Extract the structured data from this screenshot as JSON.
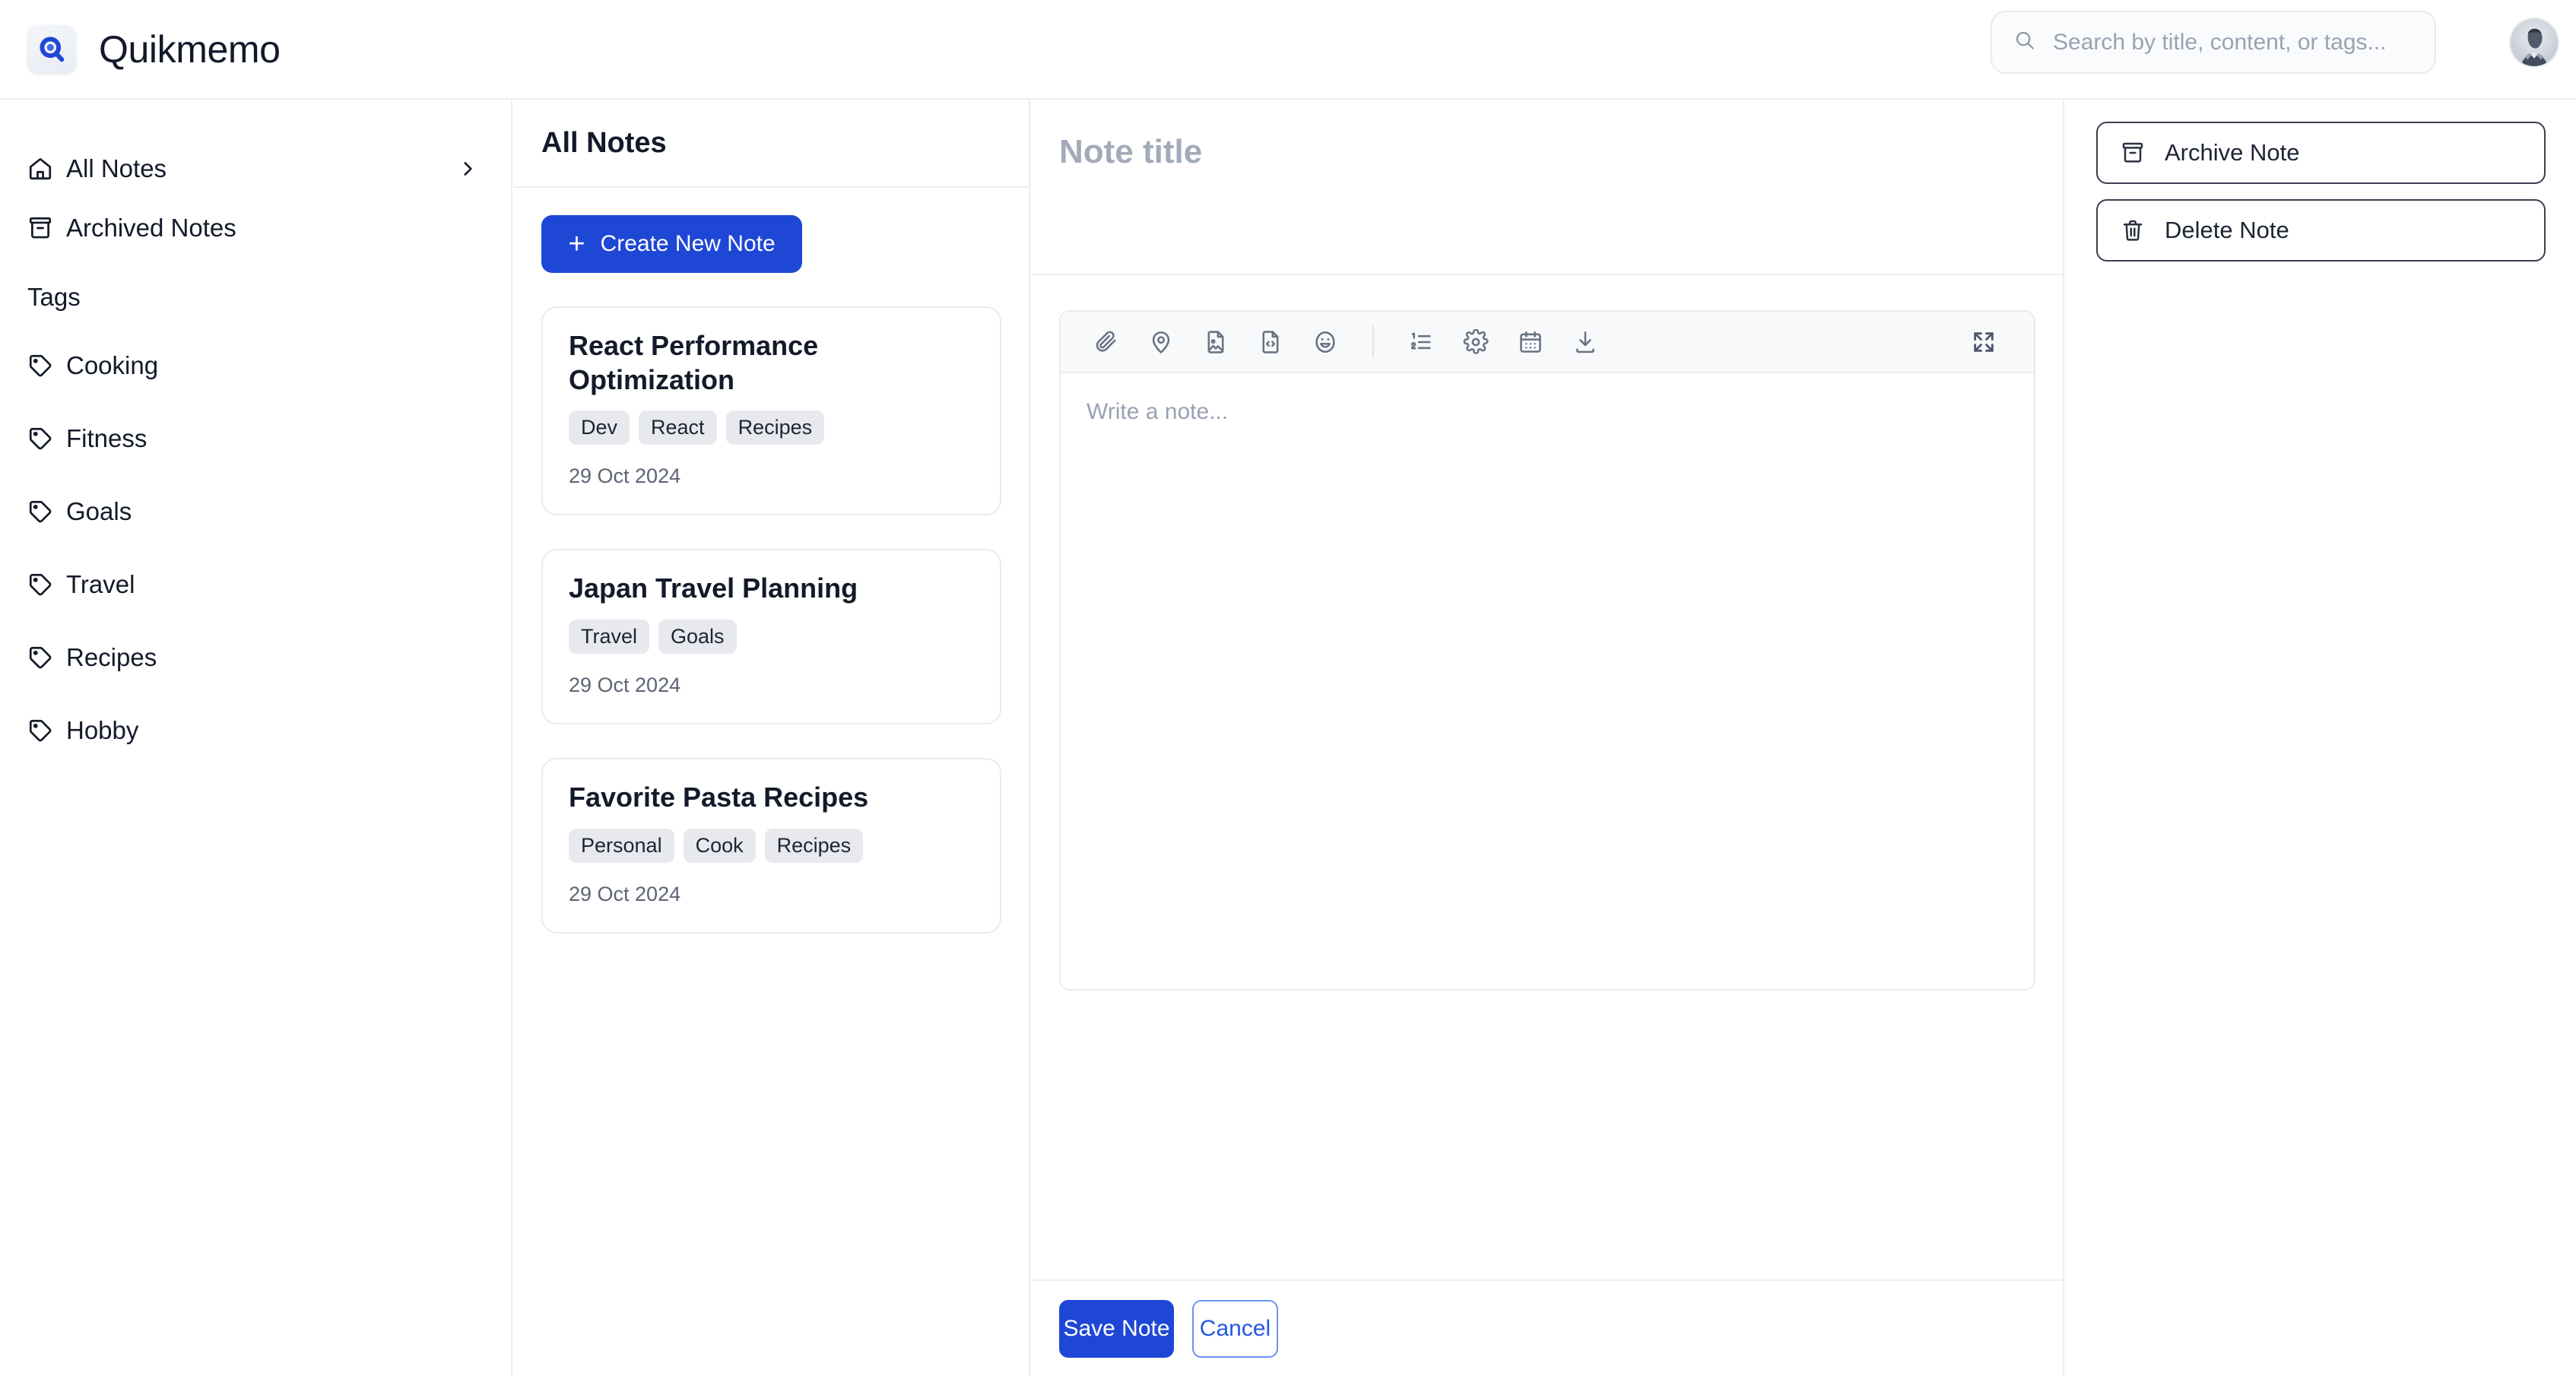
{
  "app": {
    "name": "Quikmemo",
    "logo_icon": "quikmemo-q-logo",
    "accent_color": "#1f47d6",
    "border_color": "#eceef2"
  },
  "header": {
    "search": {
      "icon": "search-icon",
      "placeholder": "Search by title, content, or tags...",
      "value": ""
    },
    "avatar_alt": "user-avatar"
  },
  "sidebar": {
    "nav": [
      {
        "label": "All Notes",
        "icon": "home-icon",
        "chevron": "chevron-right-icon"
      },
      {
        "label": "Archived Notes",
        "icon": "archive-icon"
      }
    ],
    "tags_heading": "Tags",
    "tags": [
      {
        "label": "Cooking",
        "icon": "tag-icon"
      },
      {
        "label": "Fitness",
        "icon": "tag-icon"
      },
      {
        "label": "Goals",
        "icon": "tag-icon"
      },
      {
        "label": "Travel",
        "icon": "tag-icon"
      },
      {
        "label": "Recipes",
        "icon": "tag-icon"
      },
      {
        "label": "Hobby",
        "icon": "tag-icon"
      }
    ]
  },
  "note_list": {
    "title": "All Notes",
    "create_button": {
      "label": "Create New Note",
      "icon": "plus-icon"
    },
    "notes": [
      {
        "title": "React Performance Optimization",
        "tags": [
          "Dev",
          "React",
          "Recipes"
        ],
        "date": "29 Oct 2024"
      },
      {
        "title": "Japan Travel Planning",
        "tags": [
          "Travel",
          "Goals"
        ],
        "date": "29 Oct 2024"
      },
      {
        "title": "Favorite Pasta Recipes",
        "tags": [
          "Personal",
          "Cook",
          "Recipes"
        ],
        "date": "29 Oct 2024"
      }
    ]
  },
  "editor": {
    "title_placeholder": "Note title",
    "title_value": "",
    "body_placeholder": "Write a note...",
    "body_value": "",
    "toolbar": [
      {
        "icon": "paperclip-icon",
        "name": "attach-file"
      },
      {
        "icon": "map-pin-icon",
        "name": "insert-location"
      },
      {
        "icon": "file-image-icon",
        "name": "insert-image"
      },
      {
        "icon": "file-code-icon",
        "name": "insert-code"
      },
      {
        "icon": "smile-icon",
        "name": "insert-emoji"
      },
      {
        "icon": "ordered-list-icon",
        "name": "ordered-list"
      },
      {
        "icon": "gear-icon",
        "name": "settings"
      },
      {
        "icon": "calendar-icon",
        "name": "insert-date"
      },
      {
        "icon": "download-icon",
        "name": "download-note"
      }
    ],
    "expand_icon": "expand-icon",
    "save_label": "Save Note",
    "cancel_label": "Cancel"
  },
  "actions": {
    "buttons": [
      {
        "label": "Archive Note",
        "icon": "archive-icon"
      },
      {
        "label": "Delete Note",
        "icon": "trash-icon"
      }
    ]
  }
}
